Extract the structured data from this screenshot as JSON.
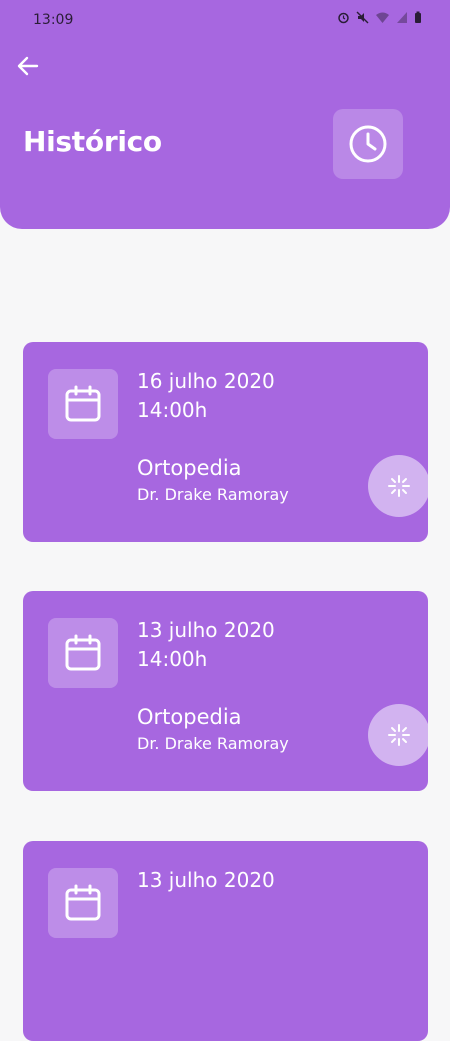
{
  "status_bar": {
    "time": "13:09"
  },
  "header": {
    "title": "Histórico"
  },
  "appointments": [
    {
      "date": "16 julho 2020",
      "time": "14:00h",
      "specialty": "Ortopedia",
      "doctor": "Dr. Drake Ramoray"
    },
    {
      "date": "13 julho 2020",
      "time": "14:00h",
      "specialty": "Ortopedia",
      "doctor": "Dr. Drake Ramoray"
    },
    {
      "date": "13 julho 2020",
      "time": "",
      "specialty": "",
      "doctor": ""
    }
  ],
  "colors": {
    "primary": "#a767e0",
    "background": "#f7f7f8",
    "action_circle": "#d2b3f0"
  },
  "icons": {
    "back": "arrow-left-icon",
    "history": "clock-icon",
    "appointment": "calendar-icon",
    "action": "sparkle-icon"
  }
}
